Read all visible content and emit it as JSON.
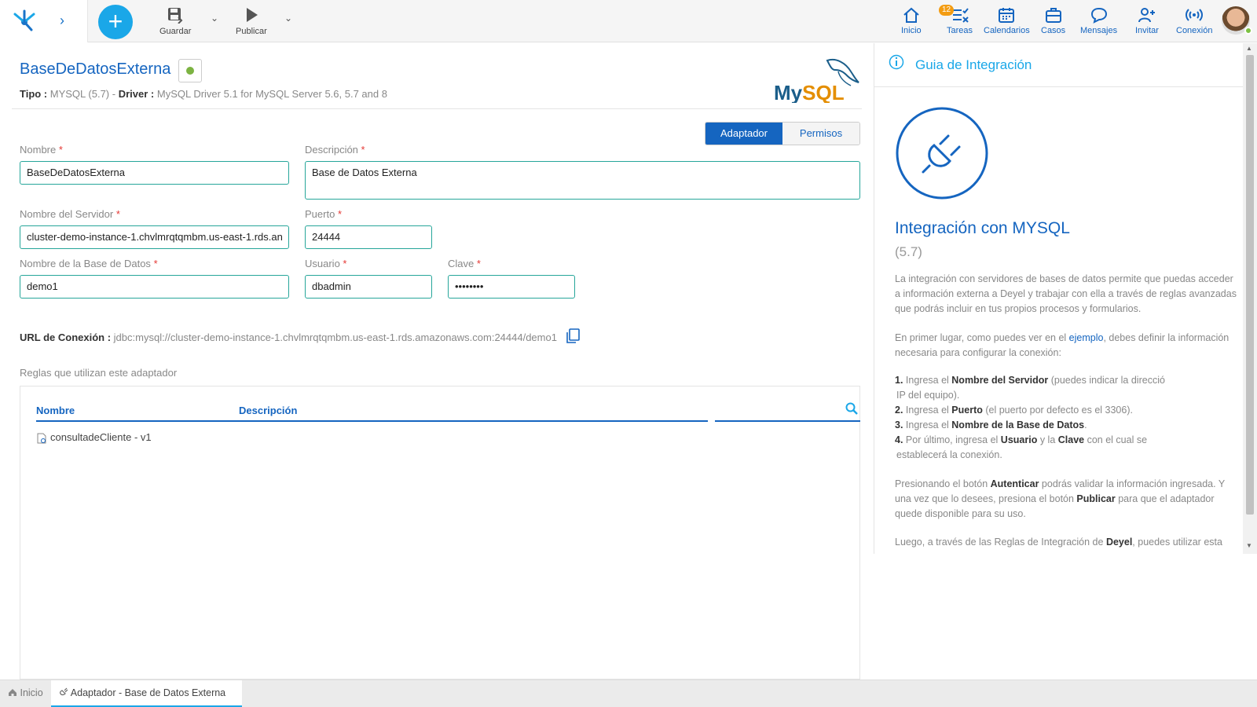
{
  "toolbar": {
    "save_label": "Guardar",
    "publish_label": "Publicar"
  },
  "nav": {
    "home": "Inicio",
    "tasks": "Tareas",
    "tasks_badge": "12",
    "calendars": "Calendarios",
    "cases": "Casos",
    "messages": "Mensajes",
    "invite": "Invitar",
    "connection": "Conexión"
  },
  "header": {
    "title": "BaseDeDatosExterna",
    "tipo_label": "Tipo :",
    "tipo_value": "MYSQL (5.7)",
    "sep": " - ",
    "driver_label": "Driver :",
    "driver_value": "MySQL Driver 5.1 for MySQL Server 5.6, 5.7 and 8",
    "logo_text": "MySQL"
  },
  "tabs": {
    "adaptador": "Adaptador",
    "permisos": "Permisos"
  },
  "form": {
    "nombre_label": "Nombre",
    "nombre_value": "BaseDeDatosExterna",
    "descripcion_label": "Descripción",
    "descripcion_value": "Base de Datos Externa",
    "servidor_label": "Nombre del Servidor",
    "servidor_value": "cluster-demo-instance-1.chvlmrqtqmbm.us-east-1.rds.an",
    "puerto_label": "Puerto",
    "puerto_value": "24444",
    "bd_label": "Nombre de la Base de Datos",
    "bd_value": "demo1",
    "usuario_label": "Usuario",
    "usuario_value": "dbadmin",
    "clave_label": "Clave",
    "clave_value": "••••••••",
    "required_mark": "*"
  },
  "url": {
    "label": "URL de Conexión :",
    "value": "jdbc:mysql://cluster-demo-instance-1.chvlmrqtqmbm.us-east-1.rds.amazonaws.com:24444/demo1"
  },
  "rules": {
    "title": "Reglas que utilizan este adaptador",
    "col_nombre": "Nombre",
    "col_descripcion": "Descripción",
    "rows": [
      {
        "name": "consultadeCliente - v1"
      }
    ]
  },
  "guide": {
    "header": "Guia de Integración",
    "title": "Integración con MYSQL",
    "version": "(5.7)",
    "p1": "La integración con servidores de bases de datos permite que puedas acceder a información externa a Deyel y trabajar con ella a través de reglas avanzadas que podrás incluir en tus propios procesos y formularios.",
    "p2_a": "En primer lugar, como puedes ver en el ",
    "p2_link": "ejemplo",
    "p2_b": ", debes definir la información necesaria para configurar la conexión:",
    "s1_n": "1.",
    "s1_a": " Ingresa el ",
    "s1_b": "Nombre del Servidor",
    "s1_c": " (puedes indicar la direcció",
    "s1_d": "IP del equipo).",
    "s2_n": "2.",
    "s2_a": " Ingresa el ",
    "s2_b": "Puerto",
    "s2_c": " (el puerto por defecto es el 3306).",
    "s3_n": "3.",
    "s3_a": " Ingresa el ",
    "s3_b": "Nombre de la Base de Datos",
    "s3_c": ".",
    "s4_n": "4.",
    "s4_a": " Por último, ingresa el ",
    "s4_b": "Usuario",
    "s4_c": " y la ",
    "s4_d": "Clave",
    "s4_e": " con el cual se",
    "s4_f": "establecerá la conexión.",
    "p3_a": "Presionando el botón ",
    "p3_b": "Autenticar",
    "p3_c": " podrás validar la información ingresada. Y una vez que lo desees, presiona el botón ",
    "p3_d": "Publicar",
    "p3_e": " para que el adaptador quede disponible para su uso.",
    "p4_a": "Luego, a través de las Reglas de Integración de ",
    "p4_b": "Deyel",
    "p4_c": ", puedes utilizar esta"
  },
  "bottom_tabs": {
    "home": "Inicio",
    "active": "Adaptador - Base de Datos Externa",
    "close": "✖"
  }
}
